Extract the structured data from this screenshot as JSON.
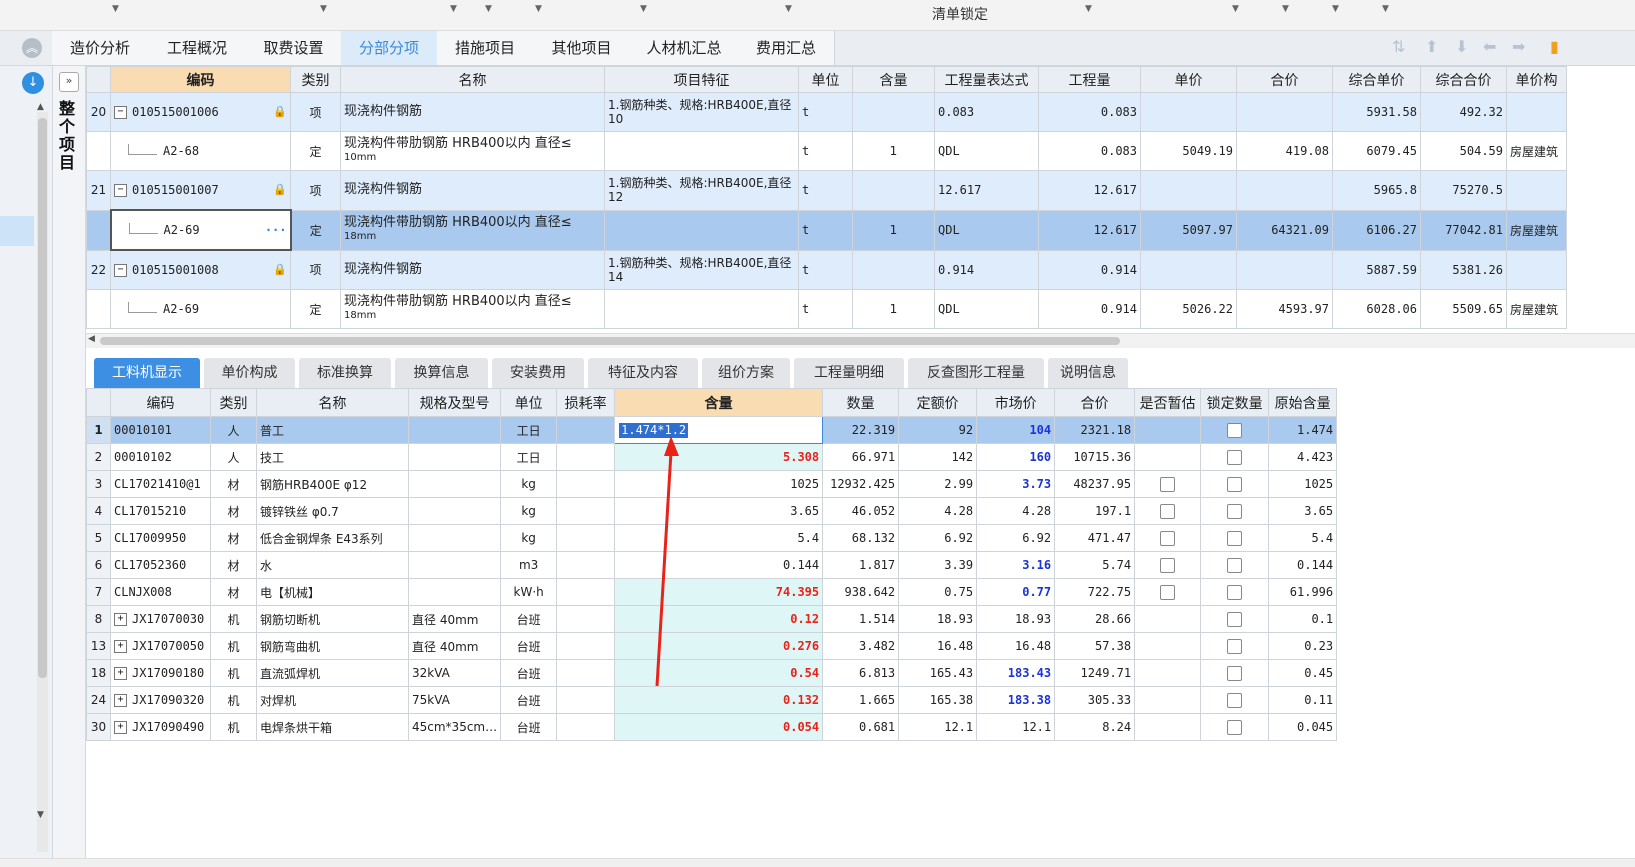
{
  "top": {
    "lock_label": "清单锁定"
  },
  "main_tabs": [
    "造价分析",
    "工程概况",
    "取费设置",
    "分部分项",
    "措施项目",
    "其他项目",
    "人材机汇总",
    "费用汇总"
  ],
  "main_tab_active": "分部分项",
  "side": {
    "expand_glyph": "»",
    "whole_project": "整个项目"
  },
  "upper": {
    "headers": [
      "编码",
      "类别",
      "名称",
      "项目特征",
      "单位",
      "含量",
      "工程量表达式",
      "工程量",
      "单价",
      "合价",
      "综合单价",
      "综合合价",
      "单价构"
    ],
    "rows": [
      {
        "no": "20",
        "code": "010515001006",
        "kind": "项",
        "name": "现浇构件钢筋",
        "feat": "1.钢筋种类、规格:HRB400E,直径10",
        "unit": "t",
        "qty_ratio": "",
        "expr": "0.083",
        "qty": "0.083",
        "price": "",
        "amount": "",
        "uprice": "5931.58",
        "total": "492.32",
        "utype": ""
      },
      {
        "no": "",
        "code": "A2-68",
        "kind": "定",
        "name": "现浇构件带肋钢筋 HRB400以内 直径≤",
        "name2": "10mm",
        "feat": "",
        "unit": "t",
        "qty_ratio": "1",
        "expr": "QDL",
        "qty": "0.083",
        "price": "5049.19",
        "amount": "419.08",
        "uprice": "6079.45",
        "total": "504.59",
        "utype": "房屋建筑"
      },
      {
        "no": "21",
        "code": "010515001007",
        "kind": "项",
        "name": "现浇构件钢筋",
        "feat": "1.钢筋种类、规格:HRB400E,直径12",
        "unit": "t",
        "qty_ratio": "",
        "expr": "12.617",
        "qty": "12.617",
        "price": "",
        "amount": "",
        "uprice": "5965.8",
        "total": "75270.5",
        "utype": ""
      },
      {
        "no": "",
        "code": "A2-69",
        "kind": "定",
        "name": "现浇构件带肋钢筋 HRB400以内 直径≤",
        "name2": "18mm",
        "feat": "",
        "unit": "t",
        "qty_ratio": "1",
        "expr": "QDL",
        "qty": "12.617",
        "price": "5097.97",
        "amount": "64321.09",
        "uprice": "6106.27",
        "total": "77042.81",
        "utype": "房屋建筑"
      },
      {
        "no": "22",
        "code": "010515001008",
        "kind": "项",
        "name": "现浇构件钢筋",
        "feat": "1.钢筋种类、规格:HRB400E,直径14",
        "unit": "t",
        "qty_ratio": "",
        "expr": "0.914",
        "qty": "0.914",
        "price": "",
        "amount": "",
        "uprice": "5887.59",
        "total": "5381.26",
        "utype": ""
      },
      {
        "no": "",
        "code": "A2-69",
        "kind": "定",
        "name": "现浇构件带肋钢筋 HRB400以内 直径≤",
        "name2": "18mm",
        "feat": "",
        "unit": "t",
        "qty_ratio": "1",
        "expr": "QDL",
        "qty": "0.914",
        "price": "5026.22",
        "amount": "4593.97",
        "uprice": "6028.06",
        "total": "5509.65",
        "utype": "房屋建筑"
      }
    ]
  },
  "sub_tabs": [
    "工料机显示",
    "单价构成",
    "标准换算",
    "换算信息",
    "安装费用",
    "特征及内容",
    "组价方案",
    "工程量明细",
    "反查图形工程量",
    "说明信息"
  ],
  "sub_tab_active": "工料机显示",
  "lower": {
    "headers": [
      "编码",
      "类别",
      "名称",
      "规格及型号",
      "单位",
      "损耗率",
      "含量",
      "数量",
      "定额价",
      "市场价",
      "合价",
      "是否暂估",
      "锁定数量",
      "原始含量"
    ],
    "rows": [
      {
        "no": "1",
        "code": "00010101",
        "kind": "人",
        "name": "普工",
        "spec": "",
        "unit": "工日",
        "loss": "",
        "hanl": "1.474*1.2",
        "qty": "22.319",
        "quota": "92",
        "market": "104",
        "amount": "2321.18",
        "est": false,
        "lock": true,
        "orig": "1.474",
        "expand": false
      },
      {
        "no": "2",
        "code": "00010102",
        "kind": "人",
        "name": "技工",
        "spec": "",
        "unit": "工日",
        "loss": "",
        "hanl": "5.308",
        "qty": "66.971",
        "quota": "142",
        "market": "160",
        "amount": "10715.36",
        "est": false,
        "lock": true,
        "orig": "4.423",
        "expand": false
      },
      {
        "no": "3",
        "code": "CL17021410@1",
        "kind": "材",
        "name": "钢筋HRB400E φ12",
        "spec": "",
        "unit": "kg",
        "loss": "",
        "hanl": "1025",
        "qty": "12932.425",
        "quota": "2.99",
        "market": "3.73",
        "amount": "48237.95",
        "est": true,
        "lock": true,
        "orig": "1025",
        "expand": false
      },
      {
        "no": "4",
        "code": "CL17015210",
        "kind": "材",
        "name": "镀锌铁丝 φ0.7",
        "spec": "",
        "unit": "kg",
        "loss": "",
        "hanl": "3.65",
        "qty": "46.052",
        "quota": "4.28",
        "market": "4.28",
        "amount": "197.1",
        "est": true,
        "lock": true,
        "orig": "3.65",
        "expand": false
      },
      {
        "no": "5",
        "code": "CL17009950",
        "kind": "材",
        "name": "低合金钢焊条 E43系列",
        "spec": "",
        "unit": "kg",
        "loss": "",
        "hanl": "5.4",
        "qty": "68.132",
        "quota": "6.92",
        "market": "6.92",
        "amount": "471.47",
        "est": true,
        "lock": true,
        "orig": "5.4",
        "expand": false
      },
      {
        "no": "6",
        "code": "CL17052360",
        "kind": "材",
        "name": "水",
        "spec": "",
        "unit": "m3",
        "loss": "",
        "hanl": "0.144",
        "qty": "1.817",
        "quota": "3.39",
        "market": "3.16",
        "amount": "5.74",
        "est": true,
        "lock": true,
        "orig": "0.144",
        "expand": false
      },
      {
        "no": "7",
        "code": "CLNJX008",
        "kind": "材",
        "name": "电【机械】",
        "spec": "",
        "unit": "kW·h",
        "loss": "",
        "hanl": "74.395",
        "qty": "938.642",
        "quota": "0.75",
        "market": "0.77",
        "amount": "722.75",
        "est": true,
        "lock": true,
        "orig": "61.996",
        "expand": false
      },
      {
        "no": "8",
        "code": "JX17070030",
        "kind": "机",
        "name": "钢筋切断机",
        "spec": "直径 40mm",
        "unit": "台班",
        "loss": "",
        "hanl": "0.12",
        "qty": "1.514",
        "quota": "18.93",
        "market": "18.93",
        "amount": "28.66",
        "est": false,
        "lock": true,
        "orig": "0.1",
        "expand": true
      },
      {
        "no": "13",
        "code": "JX17070050",
        "kind": "机",
        "name": "钢筋弯曲机",
        "spec": "直径 40mm",
        "unit": "台班",
        "loss": "",
        "hanl": "0.276",
        "qty": "3.482",
        "quota": "16.48",
        "market": "16.48",
        "amount": "57.38",
        "est": false,
        "lock": true,
        "orig": "0.23",
        "expand": true
      },
      {
        "no": "18",
        "code": "JX17090180",
        "kind": "机",
        "name": "直流弧焊机",
        "spec": "32kVA",
        "unit": "台班",
        "loss": "",
        "hanl": "0.54",
        "qty": "6.813",
        "quota": "165.43",
        "market": "183.43",
        "amount": "1249.71",
        "est": false,
        "lock": true,
        "orig": "0.45",
        "expand": true
      },
      {
        "no": "24",
        "code": "JX17090320",
        "kind": "机",
        "name": "对焊机",
        "spec": "75kVA",
        "unit": "台班",
        "loss": "",
        "hanl": "0.132",
        "qty": "1.665",
        "quota": "165.38",
        "market": "183.38",
        "amount": "305.33",
        "est": false,
        "lock": true,
        "orig": "0.11",
        "expand": true
      },
      {
        "no": "30",
        "code": "JX17090490",
        "kind": "机",
        "name": "电焊条烘干箱",
        "spec": "45cm*35cm…",
        "unit": "台班",
        "loss": "",
        "hanl": "0.054",
        "qty": "0.681",
        "quota": "12.1",
        "market": "12.1",
        "amount": "8.24",
        "est": false,
        "lock": true,
        "orig": "0.045",
        "expand": true
      }
    ],
    "red_hanl_rows": [
      "2",
      "7",
      "8",
      "13",
      "18",
      "24",
      "30"
    ],
    "blue_market_rows": [
      "1",
      "2",
      "3",
      "6",
      "7",
      "18",
      "24"
    ]
  },
  "colors": {
    "accent": "#3d8fe3",
    "red": "#e8231a",
    "blue": "#1b33d8",
    "header_hl": "#f9dcb1",
    "selected": "#a9caee"
  }
}
